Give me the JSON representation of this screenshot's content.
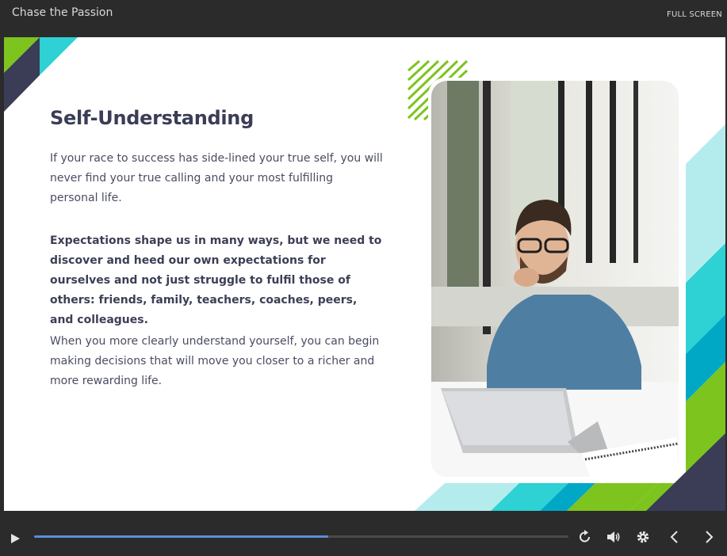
{
  "header": {
    "course_title": "Chase the Passion",
    "fullscreen_label": "FULL SCREEN"
  },
  "slide": {
    "heading": "Self-Understanding",
    "paragraphs": [
      "If your race to success has side-lined your true self, you will never find your true calling and your most fulfilling personal life.",
      "Expectations shape us in many ways, but we need to discover and heed our own expectations for ourselves and not just struggle to fulfil those of others: friends, family, teachers, coaches, peers, and colleagues.",
      "When you more clearly understand yourself, you can begin making decisions that will move you closer to a richer and more rewarding life."
    ],
    "image_description_icon": "photo-man-laptop"
  },
  "player": {
    "progress": 0.55,
    "icons": [
      "play-icon",
      "replay-icon",
      "volume-icon",
      "gear-icon",
      "chevron-left-icon",
      "chevron-right-icon"
    ]
  },
  "colors": {
    "navy": "#3a3d55",
    "lime": "#7dc41f",
    "teal": "#2ed1d4",
    "aqua_light": "#b4ecee",
    "blue_teal": "#00a8c6",
    "progress": "#5b8dd6"
  }
}
